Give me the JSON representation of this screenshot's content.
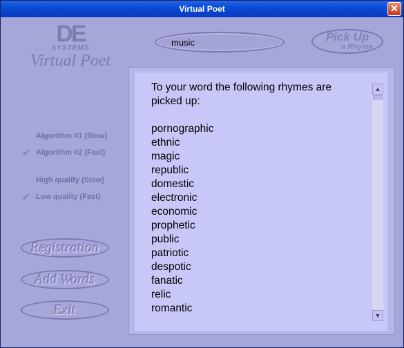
{
  "window": {
    "title": "Virtual Poet",
    "close_glyph": "✕"
  },
  "logo": {
    "mark": "DE",
    "company": "SYSTEMS",
    "product": "Virtual Poet"
  },
  "search": {
    "value": "music"
  },
  "pickup_button": {
    "line1": "Pick Up",
    "line2": "a Rhyme"
  },
  "algorithm_options": [
    {
      "label": "Algorithm #1 (Slow)",
      "checked": false
    },
    {
      "label": "Algorithm #2 (Fast)",
      "checked": true
    }
  ],
  "quality_options": [
    {
      "label": "High quality (Slow)",
      "checked": false
    },
    {
      "label": "Low quality (Fast)",
      "checked": true
    }
  ],
  "buttons": {
    "registration": "Registration",
    "add_words": "Add Words",
    "exit": "Exit"
  },
  "results": {
    "intro": "To your word the following rhymes are picked up:",
    "rhymes": [
      "pornographic",
      "ethnic",
      "magic",
      "republic",
      "domestic",
      "electronic",
      "economic",
      "prophetic",
      "public",
      "patriotic",
      "despotic",
      "fanatic",
      "relic",
      "romantic"
    ]
  },
  "colors": {
    "background": "#a6a6d9",
    "panel": "#c8c8f8",
    "titlebar": "#0a4fd8"
  }
}
